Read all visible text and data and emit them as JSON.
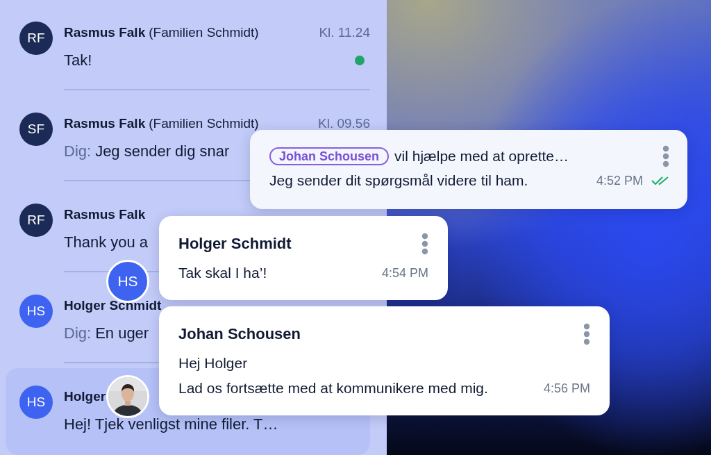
{
  "conversations": [
    {
      "initials": "RF",
      "color": "#1b2a57",
      "name": "Rasmus Falk",
      "group": "(Familien Schmidt)",
      "time": "Kl. 11.24",
      "preview": "Tak!",
      "unread": true,
      "selected": false
    },
    {
      "initials": "SF",
      "color": "#1b2a57",
      "name": "Rasmus Falk",
      "group": "(Familien Schmidt)",
      "time": "Kl. 09.56",
      "sender": "Dig:",
      "preview": "Jeg sender dig snar",
      "unread": false,
      "selected": false
    },
    {
      "initials": "RF",
      "color": "#1b2a57",
      "name": "Rasmus Falk",
      "preview": "Thank you a",
      "unread": false,
      "selected": false
    },
    {
      "initials": "HS",
      "color": "#3d63f0",
      "name": "Holger Schmidt",
      "sender": "Dig:",
      "preview": "En uger",
      "unread": false,
      "selected": false
    },
    {
      "initials": "HS",
      "color": "#3d63f0",
      "name": "Holger",
      "preview": "Hej! Tjek venligst mine filer. T…",
      "unread": false,
      "selected": true
    }
  ],
  "messages": [
    {
      "kind": "mention",
      "mention": "Johan Schousen",
      "text": "vil hjælpe med at oprette…",
      "body": "Jeg sender dit spørgsmål videre til ham.",
      "time": "4:52 PM",
      "read": true
    },
    {
      "kind": "message",
      "sender": "Holger Schmidt",
      "lines": [
        "Tak skal I ha’!"
      ],
      "time": "4:54 PM",
      "avatar": {
        "kind": "initials",
        "initials": "HS"
      }
    },
    {
      "kind": "message",
      "sender": "Johan Schousen",
      "lines": [
        "Hej Holger",
        "Lad os fortsætte med at kommunikere med mig."
      ],
      "time": "4:56 PM",
      "avatar": {
        "kind": "picture"
      }
    }
  ]
}
